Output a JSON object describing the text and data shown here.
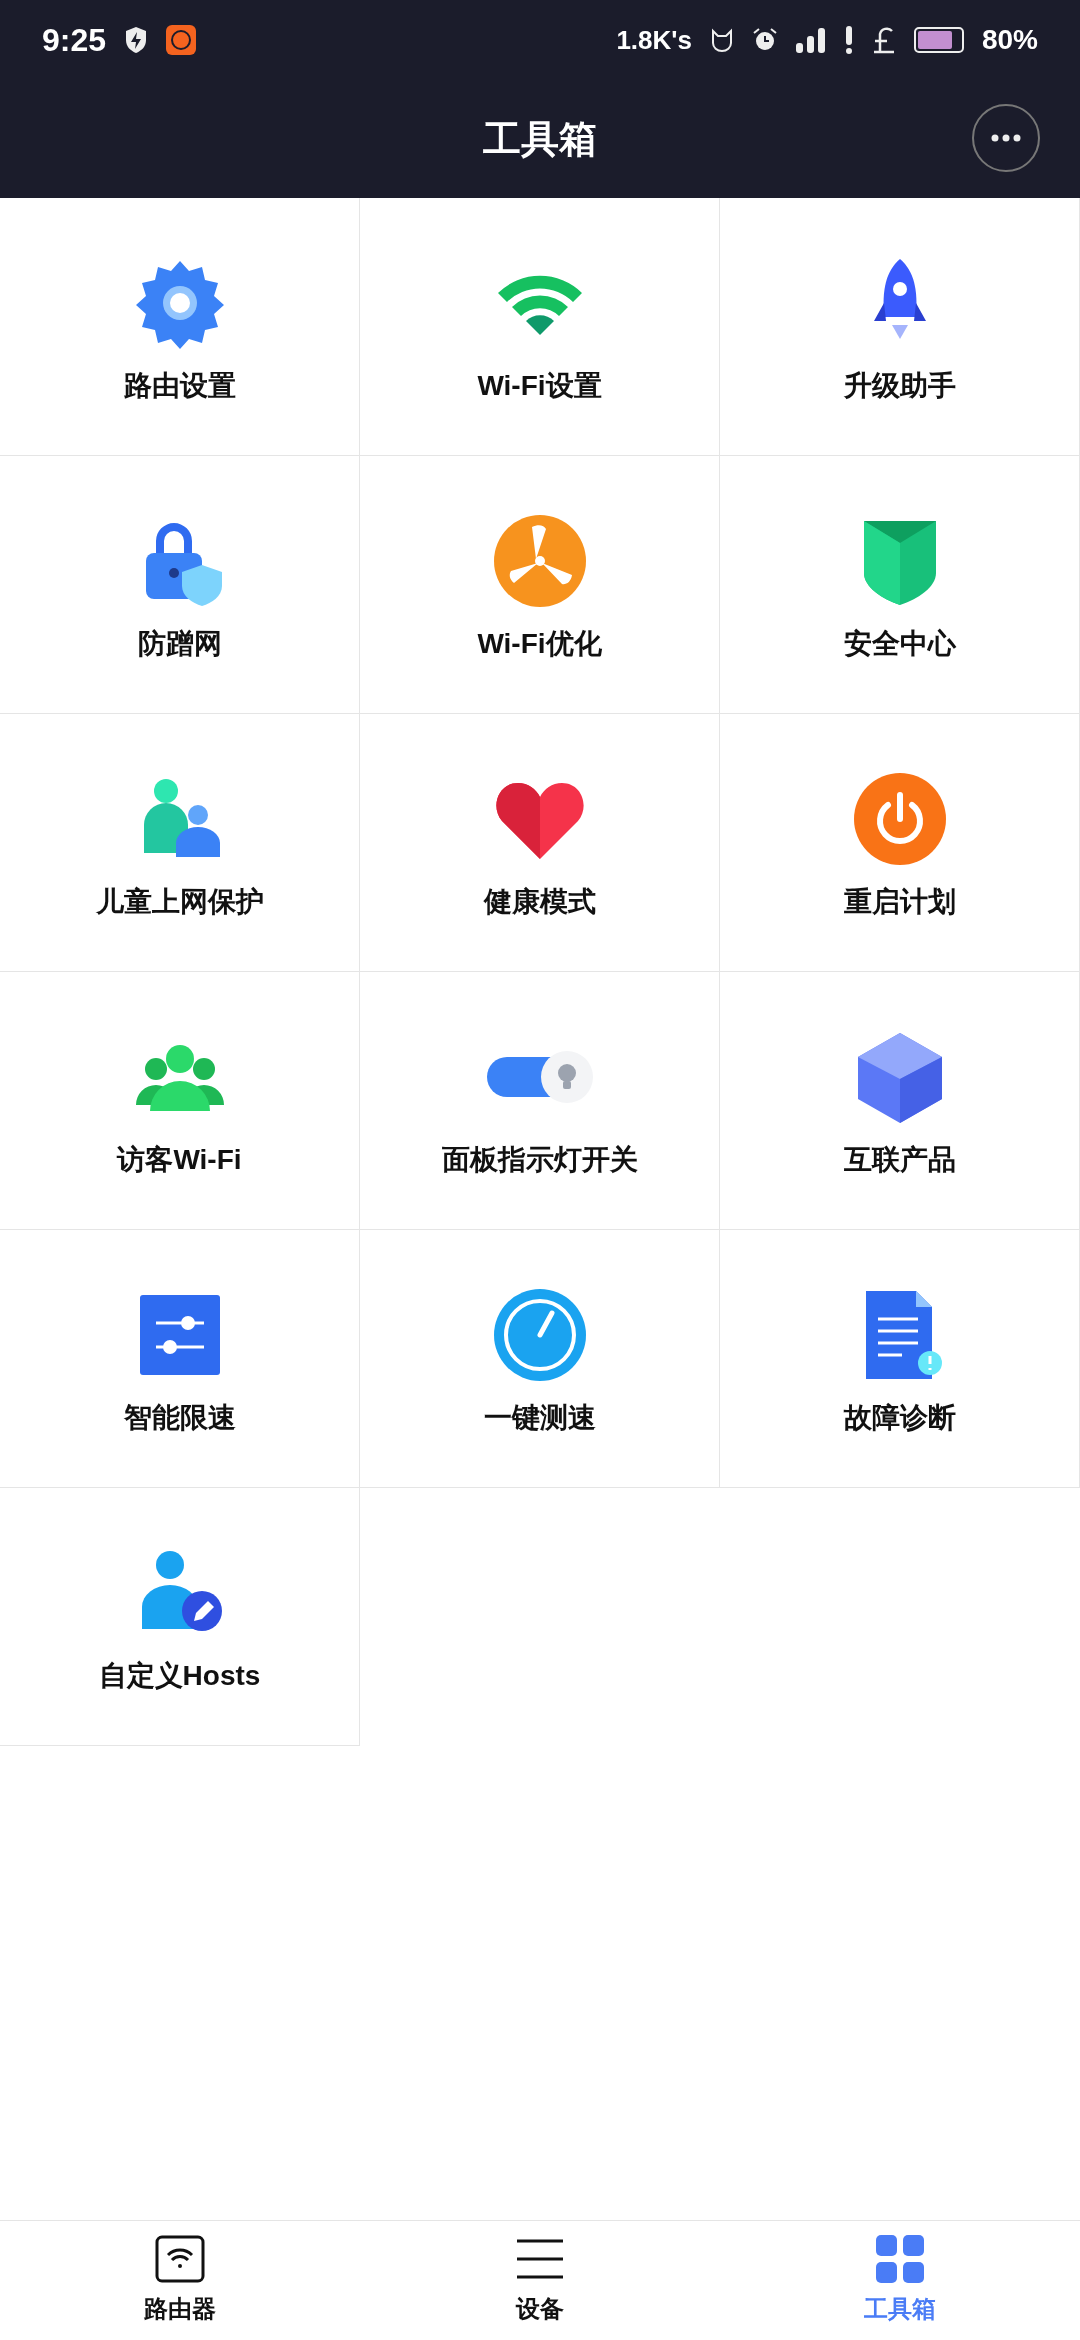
{
  "status_bar": {
    "time": "9:25",
    "speed": "1.8K's",
    "battery": "80%"
  },
  "header": {
    "title": "工具箱"
  },
  "tools": [
    {
      "label": "路由设置",
      "kind": "gear"
    },
    {
      "label": "Wi-Fi设置",
      "kind": "wifi"
    },
    {
      "label": "升级助手",
      "kind": "rocket"
    },
    {
      "label": "防蹭网",
      "kind": "lock"
    },
    {
      "label": "Wi-Fi优化",
      "kind": "fan"
    },
    {
      "label": "安全中心",
      "kind": "shield"
    },
    {
      "label": "儿童上网保护",
      "kind": "kids"
    },
    {
      "label": "健康模式",
      "kind": "heart"
    },
    {
      "label": "重启计划",
      "kind": "power"
    },
    {
      "label": "访客Wi-Fi",
      "kind": "guests"
    },
    {
      "label": "面板指示灯开关",
      "kind": "toggle"
    },
    {
      "label": "互联产品",
      "kind": "cube"
    },
    {
      "label": "智能限速",
      "kind": "sliders"
    },
    {
      "label": "一键测速",
      "kind": "gauge"
    },
    {
      "label": "故障诊断",
      "kind": "doc"
    },
    {
      "label": "自定义Hosts",
      "kind": "person"
    }
  ],
  "nav": [
    {
      "label": "路由器",
      "kind": "router",
      "selected": false
    },
    {
      "label": "设备",
      "kind": "list",
      "selected": false
    },
    {
      "label": "工具箱",
      "kind": "grid",
      "selected": true
    }
  ]
}
